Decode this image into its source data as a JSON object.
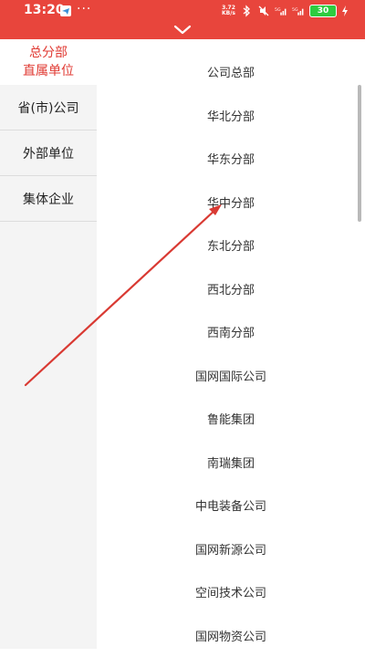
{
  "status_bar": {
    "time": "13:20",
    "dots": "···",
    "net_speed_value": "3.72",
    "net_speed_unit": "KB/s",
    "battery": "30",
    "icons": [
      "telegram-icon",
      "bluetooth-icon",
      "mute-icon",
      "5g-signal-icon",
      "signal-icon",
      "charging-icon"
    ]
  },
  "header": {
    "icon": "chevron-down-icon",
    "accent_color": "#e8453c"
  },
  "sidebar": {
    "active_line1": "总分部",
    "active_line2": "直属单位",
    "items": [
      "省(市)公司",
      "外部单位",
      "集体企业"
    ]
  },
  "list": {
    "items": [
      "公司总部",
      "华北分部",
      "华东分部",
      "华中分部",
      "东北分部",
      "西北分部",
      "西南分部",
      "国网国际公司",
      "鲁能集团",
      "南瑞集团",
      "中电装备公司",
      "国网新源公司",
      "空间技术公司",
      "国网物资公司"
    ]
  },
  "colors": {
    "active_text": "#e03a33",
    "sidebar_bg": "#f4f4f4",
    "annotation_arrow": "#d93a33"
  }
}
